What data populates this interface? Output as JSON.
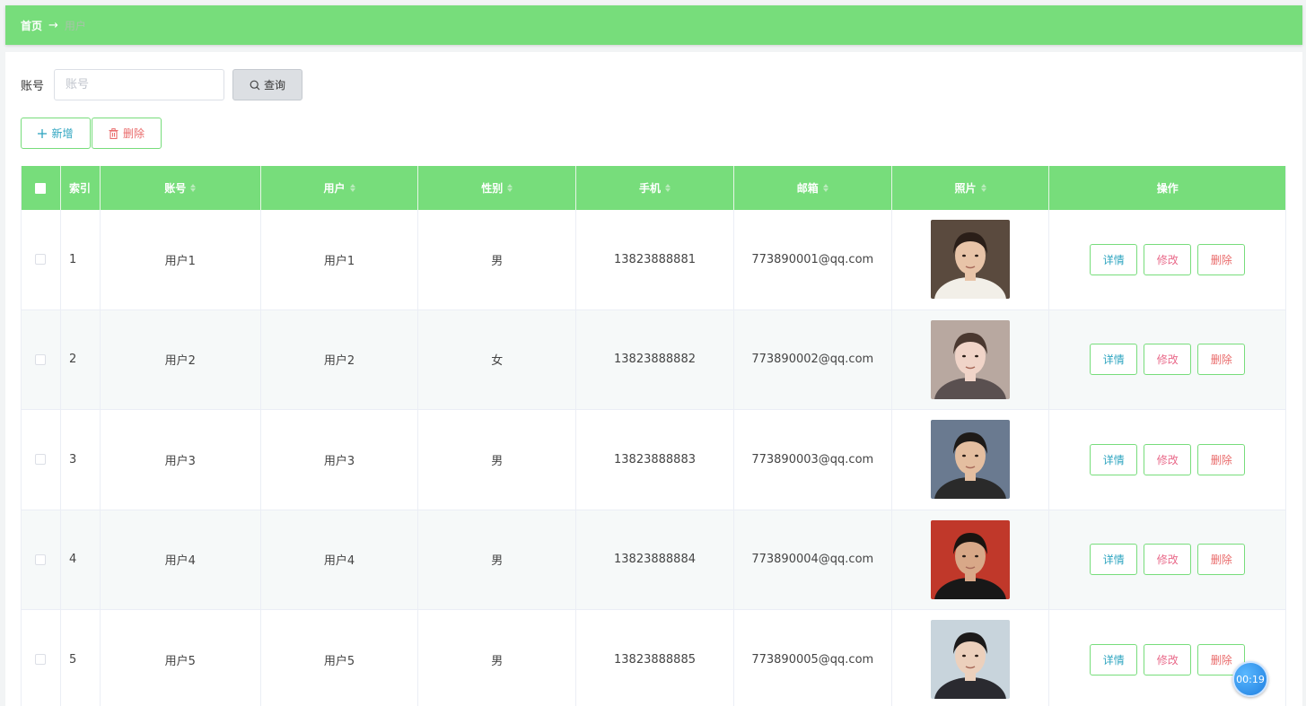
{
  "breadcrumb": {
    "home": "首页",
    "arrow": "→",
    "current": "用户"
  },
  "search": {
    "label": "账号",
    "placeholder": "账号",
    "value": "",
    "button_label": "查询"
  },
  "actions": {
    "add_label": "新增",
    "delete_label": "删除"
  },
  "table": {
    "headers": {
      "index": "索引",
      "account": "账号",
      "user": "用户",
      "gender": "性别",
      "phone": "手机",
      "email": "邮箱",
      "photo": "照片",
      "operation": "操作"
    },
    "row_buttons": {
      "detail": "详情",
      "edit": "修改",
      "delete": "删除"
    },
    "rows": [
      {
        "index": "1",
        "account": "用户1",
        "user": "用户1",
        "gender": "男",
        "phone": "13823888881",
        "email": "773890001@qq.com"
      },
      {
        "index": "2",
        "account": "用户2",
        "user": "用户2",
        "gender": "女",
        "phone": "13823888882",
        "email": "773890002@qq.com"
      },
      {
        "index": "3",
        "account": "用户3",
        "user": "用户3",
        "gender": "男",
        "phone": "13823888883",
        "email": "773890003@qq.com"
      },
      {
        "index": "4",
        "account": "用户4",
        "user": "用户4",
        "gender": "男",
        "phone": "13823888884",
        "email": "773890004@qq.com"
      },
      {
        "index": "5",
        "account": "用户5",
        "user": "用户5",
        "gender": "男",
        "phone": "13823888885",
        "email": "773890005@qq.com"
      }
    ]
  },
  "timer": "00:19",
  "colors": {
    "header_green": "#77dd7b",
    "detail_text": "#2fa5c0",
    "delete_text": "#e96a6a"
  }
}
